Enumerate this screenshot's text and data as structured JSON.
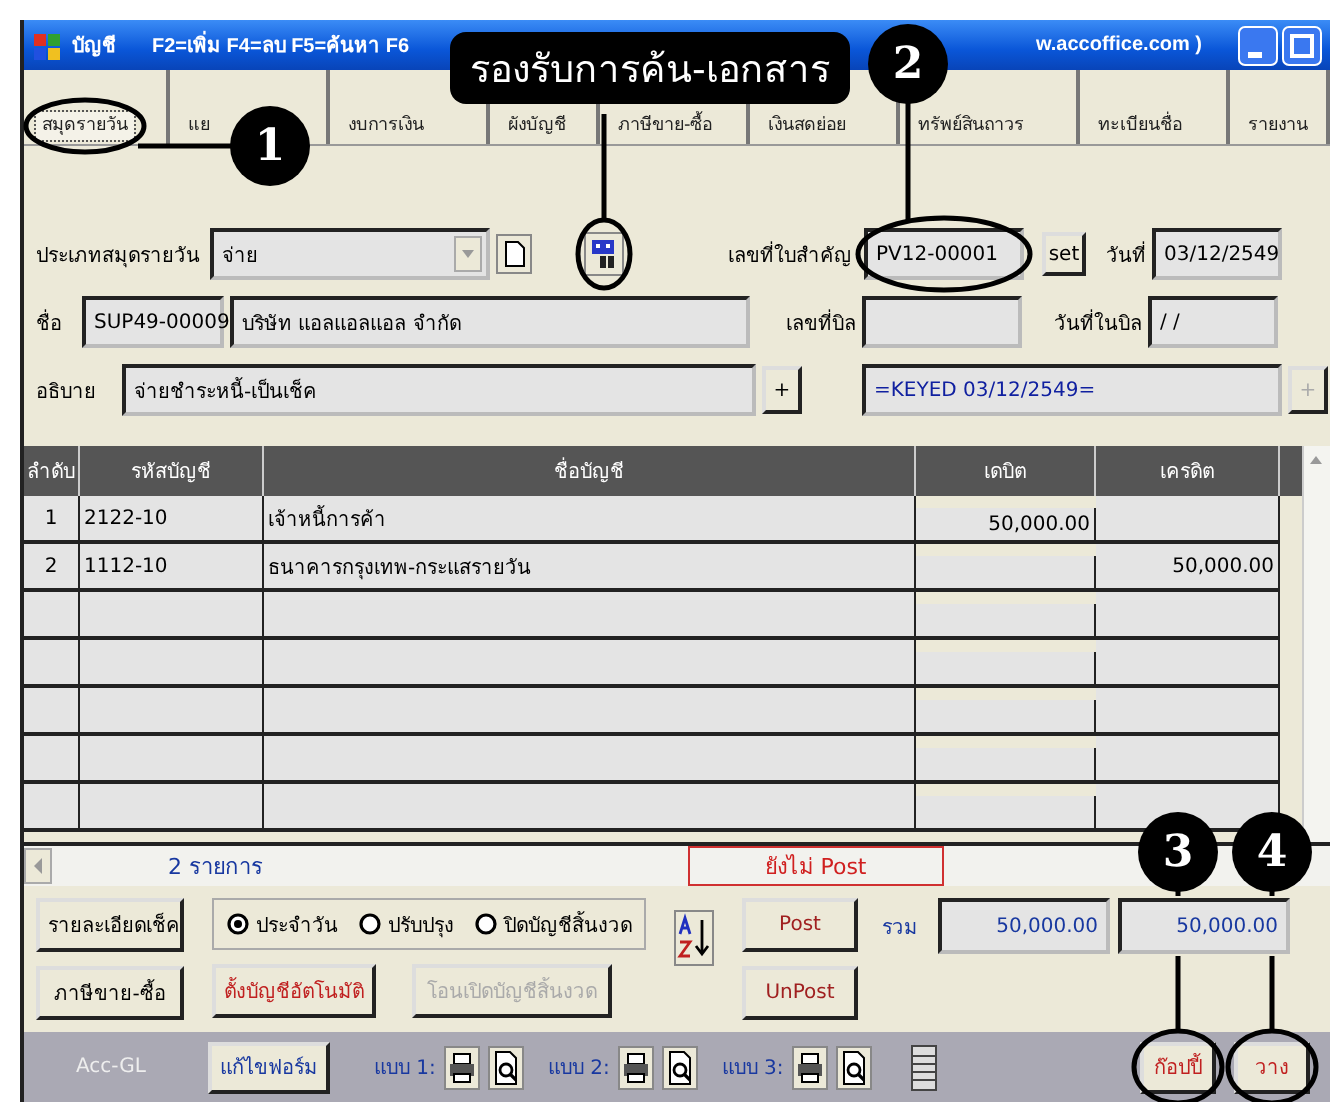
{
  "window": {
    "app_name": "บัญชี",
    "title": "F2=เพิ่ม F4=ลบ F5=ค้นหา F6",
    "title_tail": "w.accoffice.com )"
  },
  "tabs": [
    {
      "label": "สมุดรายวัน",
      "selected": true
    },
    {
      "label": "แย",
      "selected": false
    },
    {
      "label": "งบการเงิน",
      "selected": false
    },
    {
      "label": "ผังบัญชี",
      "selected": false
    },
    {
      "label": "ภาษีขาย-ซื้อ",
      "selected": false
    },
    {
      "label": "เงินสดย่อย",
      "selected": false
    },
    {
      "label": "ทรัพย์สินถาวร",
      "selected": false
    },
    {
      "label": "ทะเบียนชื่อ",
      "selected": false
    },
    {
      "label": "รายงาน",
      "selected": false
    }
  ],
  "form": {
    "journal_type": {
      "label": "ประเภทสมุดรายวัน",
      "value": "จ่าย"
    },
    "voucher_no": {
      "label": "เลขที่ใบสำคัญ",
      "value": "PV12-00001"
    },
    "set_button": "set",
    "date": {
      "label": "วันที่",
      "value": "03/12/2549"
    },
    "name": {
      "label": "ชื่อ",
      "code": "SUP49-00009",
      "value": "บริษัท แอลแอลแอล จำกัด"
    },
    "bill_no": {
      "label": "เลขที่บิล"
    },
    "bill_date": {
      "label": "วันที่ในบิล",
      "value": "/ /"
    },
    "description": {
      "label": "อธิบาย",
      "value": "จ่ายชำระหนี้-เป็นเช็ค"
    },
    "add_button": "+",
    "note": "=KEYED 03/12/2549=",
    "side_button": "+"
  },
  "table": {
    "columns": [
      "ลำดับ",
      "รหัสบัญชี",
      "ชื่อบัญชี",
      "เดบิต",
      "เครดิต"
    ],
    "rows": [
      {
        "no": "1",
        "code": "2122-10",
        "name": "เจ้าหนี้การค้า",
        "debit": "50,000.00"
      },
      {
        "no": "2",
        "code": "1112-10",
        "name": "ธนาคารกรุงเทพ-กระแสรายวัน",
        "credit": "50,000.00"
      }
    ]
  },
  "status": {
    "count": "2 รายการ",
    "post_state": "ยังไม่ Post"
  },
  "side_buttons": [
    "รายละเอียดเช็ค",
    "ภาษีขาย-ซื้อ"
  ],
  "entry_type": [
    {
      "label": "ประจำวัน",
      "selected": true
    },
    {
      "label": "ปรับปรุง",
      "selected": false
    },
    {
      "label": "ปิดบัญชีสิ้นงวด",
      "selected": false
    }
  ],
  "auto_buttons": [
    {
      "label": "ตั้งบัญชีอัตโนมัติ",
      "disabled": false
    },
    {
      "label": "โอนเปิดบัญชีสิ้นงวด",
      "disabled": true
    }
  ],
  "post_buttons": [
    "Post",
    "UnPost"
  ],
  "totals": {
    "label": "รวม",
    "debit": "50,000.00",
    "credit": "50,000.00"
  },
  "bottom_bar": {
    "module": "Acc-GL",
    "edit_form": "แก้ไขฟอร์ม",
    "print_layouts": [
      "แบบ 1:",
      "แบบ 2:",
      "แบบ 3:"
    ],
    "copy": "ก๊อปปี้",
    "paste": "วาง"
  },
  "annotations": {
    "callout": "รองรับการค้น-เอกสาร",
    "markers": [
      "1",
      "2",
      "3",
      "4"
    ]
  }
}
